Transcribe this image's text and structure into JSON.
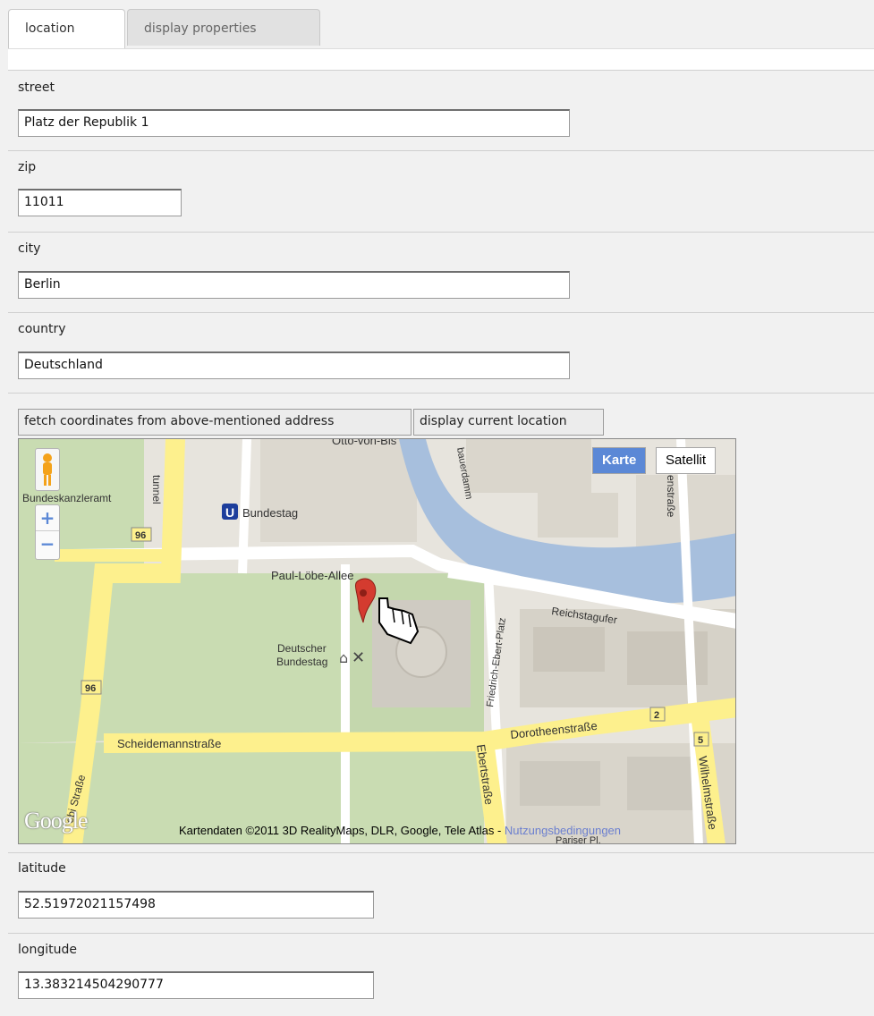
{
  "tabs": [
    {
      "label": "location",
      "active": true
    },
    {
      "label": "display properties",
      "active": false
    }
  ],
  "form": {
    "street": {
      "label": "street",
      "value": "Platz der Republik 1"
    },
    "zip": {
      "label": "zip",
      "value": "11011"
    },
    "city": {
      "label": "city",
      "value": "Berlin"
    },
    "country": {
      "label": "country",
      "value": "Deutschland"
    },
    "latitude": {
      "label": "latitude",
      "value": "52.51972021157498"
    },
    "longitude": {
      "label": "longitude",
      "value": "13.383214504290777"
    }
  },
  "buttons": {
    "fetch": "fetch coordinates from above-mentioned address",
    "display": "display current location"
  },
  "map": {
    "type_control": {
      "map_label": "Karte",
      "satellite_label": "Satellit"
    },
    "zoom_in": "+",
    "zoom_out": "−",
    "logo": "Google",
    "attribution": "Kartendaten ©2011 3D RealityMaps, DLR, Google, Tele Atlas - ",
    "terms_link": "Nutzungsbedingungen",
    "labels": {
      "otto": "Otto-von-Bis",
      "bundeskanzleramt": "Bundeskanzleramt",
      "ubahn_letter": "U",
      "ubahn_station": "Bundestag",
      "road96a": "96",
      "road96b": "96",
      "paul": "Paul-Löbe-Allee",
      "reichstagufer": "Reichstagufer",
      "bundestag1": "Deutscher",
      "bundestag2": "Bundestag",
      "friedrich": "Friedrich-Ebert-Platz",
      "dorotheen": "Dorotheenstraße",
      "scheidemann": "Scheidemannstraße",
      "ebert": "Ebertstraße",
      "wilhelm": "Wilhelmstraße",
      "road2": "2",
      "road5": "5",
      "bauer": "bauerdamm",
      "enstrasse": "enstraße",
      "tunnel": "tunnel",
      "ebi": "ebi Straße",
      "pariser": "Pariser Pl."
    },
    "colors": {
      "water": "#a7bfdd",
      "park": "#c9dcb2",
      "road_major": "#fdf08d",
      "marker": "#d43b2f"
    }
  }
}
